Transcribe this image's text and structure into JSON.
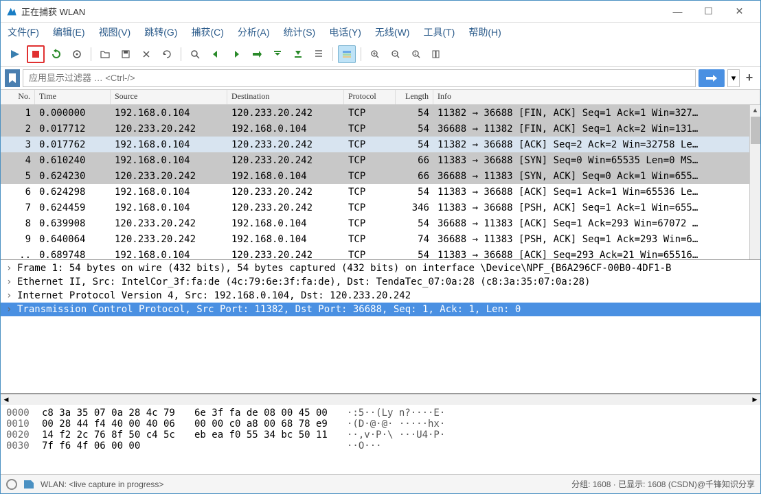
{
  "window": {
    "title": "正在捕获 WLAN"
  },
  "menu": {
    "file": "文件(F)",
    "edit": "编辑(E)",
    "view": "视图(V)",
    "go": "跳转(G)",
    "capture": "捕获(C)",
    "analyze": "分析(A)",
    "statistics": "统计(S)",
    "telephony": "电话(Y)",
    "wireless": "无线(W)",
    "tools": "工具(T)",
    "help": "帮助(H)"
  },
  "filter": {
    "placeholder": "应用显示过滤器 … <Ctrl-/>"
  },
  "packet_columns": {
    "no": "No.",
    "time": "Time",
    "source": "Source",
    "destination": "Destination",
    "protocol": "Protocol",
    "length": "Length",
    "info": "Info"
  },
  "packets": [
    {
      "no": "1",
      "time": "0.000000",
      "src": "192.168.0.104",
      "dst": "120.233.20.242",
      "proto": "TCP",
      "len": "54",
      "info": "11382 → 36688 [FIN, ACK] Seq=1 Ack=1 Win=327…",
      "cls": "gray"
    },
    {
      "no": "2",
      "time": "0.017712",
      "src": "120.233.20.242",
      "dst": "192.168.0.104",
      "proto": "TCP",
      "len": "54",
      "info": "36688 → 11382 [FIN, ACK] Seq=1 Ack=2 Win=131…",
      "cls": "gray"
    },
    {
      "no": "3",
      "time": "0.017762",
      "src": "192.168.0.104",
      "dst": "120.233.20.242",
      "proto": "TCP",
      "len": "54",
      "info": "11382 → 36688 [ACK] Seq=2 Ack=2 Win=32758 Le…",
      "cls": "sel"
    },
    {
      "no": "4",
      "time": "0.610240",
      "src": "192.168.0.104",
      "dst": "120.233.20.242",
      "proto": "TCP",
      "len": "66",
      "info": "11383 → 36688 [SYN] Seq=0 Win=65535 Len=0 MS…",
      "cls": "gray"
    },
    {
      "no": "5",
      "time": "0.624230",
      "src": "120.233.20.242",
      "dst": "192.168.0.104",
      "proto": "TCP",
      "len": "66",
      "info": "36688 → 11383 [SYN, ACK] Seq=0 Ack=1 Win=655…",
      "cls": "gray"
    },
    {
      "no": "6",
      "time": "0.624298",
      "src": "192.168.0.104",
      "dst": "120.233.20.242",
      "proto": "TCP",
      "len": "54",
      "info": "11383 → 36688 [ACK] Seq=1 Ack=1 Win=65536 Le…",
      "cls": ""
    },
    {
      "no": "7",
      "time": "0.624459",
      "src": "192.168.0.104",
      "dst": "120.233.20.242",
      "proto": "TCP",
      "len": "346",
      "info": "11383 → 36688 [PSH, ACK] Seq=1 Ack=1 Win=655…",
      "cls": ""
    },
    {
      "no": "8",
      "time": "0.639908",
      "src": "120.233.20.242",
      "dst": "192.168.0.104",
      "proto": "TCP",
      "len": "54",
      "info": "36688 → 11383 [ACK] Seq=1 Ack=293 Win=67072 …",
      "cls": ""
    },
    {
      "no": "9",
      "time": "0.640064",
      "src": "120.233.20.242",
      "dst": "192.168.0.104",
      "proto": "TCP",
      "len": "74",
      "info": "36688 → 11383 [PSH, ACK] Seq=1 Ack=293 Win=6…",
      "cls": ""
    },
    {
      "no": "..",
      "time": "0.689748",
      "src": "192.168.0.104",
      "dst": "120.233.20.242",
      "proto": "TCP",
      "len": "54",
      "info": "11383 → 36688 [ACK] Seq=293 Ack=21 Win=65516…",
      "cls": ""
    }
  ],
  "details": [
    {
      "text": "Frame 1: 54 bytes on wire (432 bits), 54 bytes captured (432 bits) on interface \\Device\\NPF_{B6A296CF-00B0-4DF1-B",
      "sel": false
    },
    {
      "text": "Ethernet II, Src: IntelCor_3f:fa:de (4c:79:6e:3f:fa:de), Dst: TendaTec_07:0a:28 (c8:3a:35:07:0a:28)",
      "sel": false
    },
    {
      "text": "Internet Protocol Version 4, Src: 192.168.0.104, Dst: 120.233.20.242",
      "sel": false
    },
    {
      "text": "Transmission Control Protocol, Src Port: 11382, Dst Port: 36688, Seq: 1, Ack: 1, Len: 0",
      "sel": true
    }
  ],
  "bytes": [
    {
      "off": "0000",
      "h1": "c8 3a 35 07 0a 28 4c 79",
      "h2": "6e 3f fa de 08 00 45 00",
      "asc": "·:5··(Ly n?····E·"
    },
    {
      "off": "0010",
      "h1": "00 28 44 f4 40 00 40 06",
      "h2": "00 00 c0 a8 00 68 78 e9",
      "asc": "·(D·@·@· ·····hx·"
    },
    {
      "off": "0020",
      "h1": "14 f2 2c 76 8f 50 c4 5c",
      "h2": "eb ea f0 55 34 bc 50 11",
      "asc": "··,v·P·\\ ···U4·P·"
    },
    {
      "off": "0030",
      "h1": "7f f6 4f 06 00 00",
      "h2": "",
      "asc": "··O···"
    }
  ],
  "status": {
    "left": "WLAN: <live capture in progress>",
    "right": "分组: 1608 · 已显示: 1608 (CSDN)@千锋知识分享"
  }
}
